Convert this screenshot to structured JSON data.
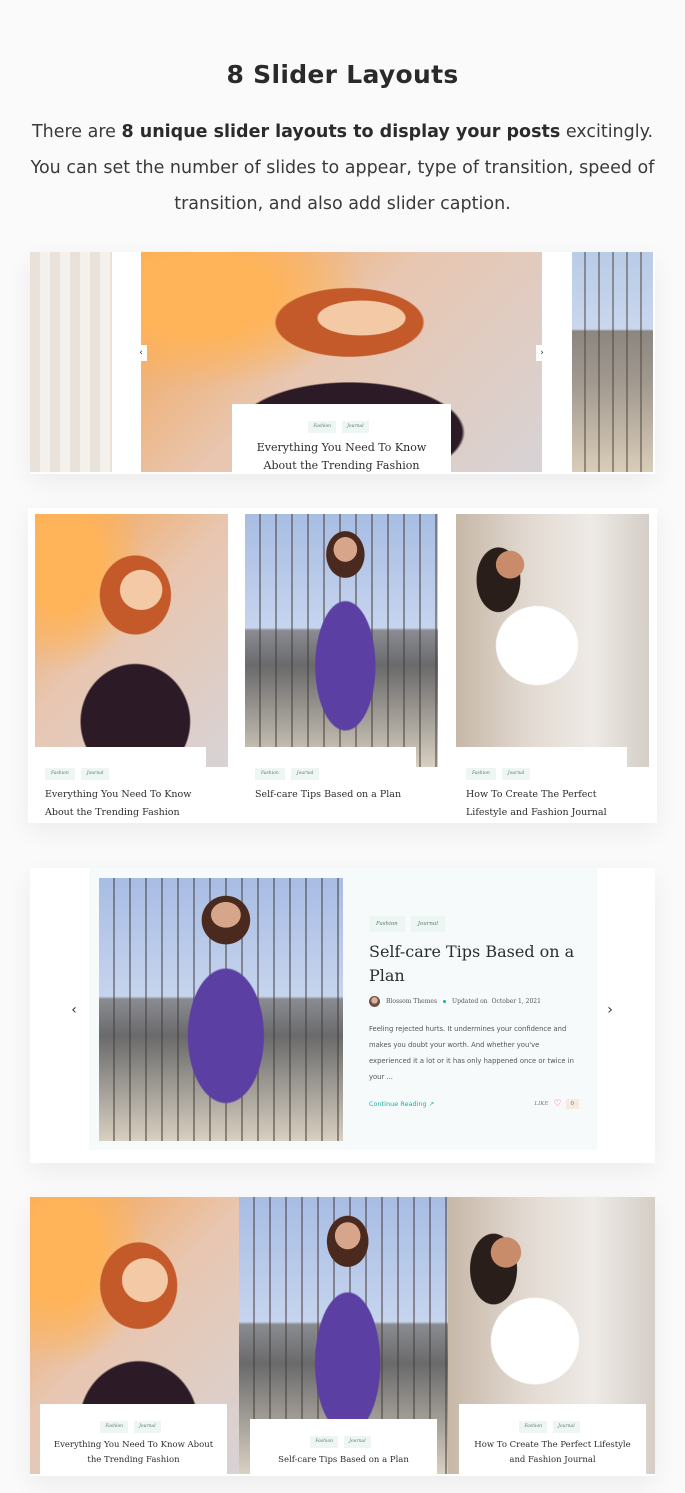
{
  "section": {
    "title": "8 Slider Layouts",
    "intro_prefix": "There are ",
    "intro_bold": "8 unique slider layouts to display your posts",
    "intro_suffix": " excitingly. You can set the number of slides to appear, type of transition, speed of transition, and also add slider caption."
  },
  "tags": {
    "fashion": "Fashion",
    "journal": "Journal"
  },
  "posts": [
    {
      "title": "Everything You Need To Know About the Trending Fashion"
    },
    {
      "title": "Self-care Tips Based on a Plan"
    },
    {
      "title": "How To Create The Perfect Lifestyle and Fashion Journal"
    }
  ],
  "slider1": {
    "prev_icon": "‹",
    "next_icon": "›",
    "caption_title": "Everything You Need To Know About the Trending Fashion"
  },
  "slider3": {
    "prev_icon": "‹",
    "next_icon": "›",
    "title": "Self-care Tips Based on a Plan",
    "author": "Blossom Themes",
    "updated_label": "Updated on",
    "date": "October 1, 2021",
    "excerpt": "Feeling rejected hurts. It undermines your confidence and makes you doubt your worth. And whether you've experienced it a lot or it has only happened once or twice in your ...",
    "continue_label": "Continue Reading",
    "continue_icon": "↗",
    "like_label": "LIKE",
    "like_icon": "♡",
    "like_count": "0"
  },
  "colors": {
    "accent": "#17b3a6",
    "tag_bg": "#eef6f3",
    "heart": "#e0456b"
  }
}
